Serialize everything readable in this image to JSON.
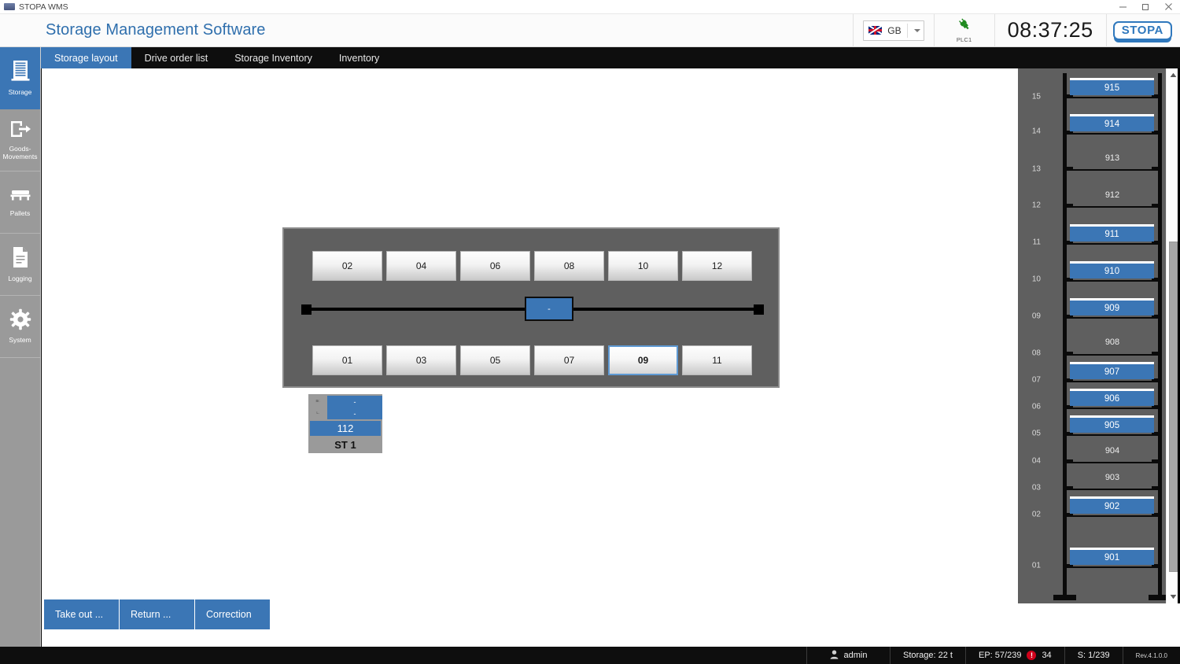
{
  "window": {
    "title": "STOPA WMS",
    "icon": "app-icon",
    "controls": [
      {
        "name": "minimize",
        "glyph": "─"
      },
      {
        "name": "restore",
        "glyph": "❐"
      },
      {
        "name": "close",
        "glyph": "✕"
      }
    ]
  },
  "header": {
    "title": "Storage Management Software",
    "language": {
      "code": "GB",
      "flag": "uk-flag-icon",
      "caret": "chevron-down-icon"
    },
    "plc": {
      "label": "PLC1",
      "icon": "plug-connected-icon",
      "status_color": "#1f8a1f"
    },
    "clock": "08:37:25",
    "logo": "STOPA"
  },
  "sidebar": {
    "items": [
      {
        "label": "Storage",
        "icon": "storage-rack-icon",
        "active": true
      },
      {
        "label": "Goods-\nMovements",
        "icon": "goods-movement-icon",
        "active": false
      },
      {
        "label": "Pallets",
        "icon": "pallet-icon",
        "active": false
      },
      {
        "label": "Logging",
        "icon": "document-log-icon",
        "active": false
      },
      {
        "label": "System",
        "icon": "gear-icon",
        "active": false
      }
    ]
  },
  "tabs": [
    {
      "label": "Storage layout",
      "active": true
    },
    {
      "label": "Drive order list",
      "active": false
    },
    {
      "label": "Storage Inventory",
      "active": false
    },
    {
      "label": "Inventory",
      "active": false
    }
  ],
  "storage_layout": {
    "top_row": [
      {
        "label": "02",
        "selected": false
      },
      {
        "label": "04",
        "selected": false
      },
      {
        "label": "06",
        "selected": false
      },
      {
        "label": "08",
        "selected": false
      },
      {
        "label": "10",
        "selected": false
      },
      {
        "label": "12",
        "selected": false
      }
    ],
    "bottom_row": [
      {
        "label": "01",
        "selected": false
      },
      {
        "label": "03",
        "selected": false
      },
      {
        "label": "05",
        "selected": false
      },
      {
        "label": "07",
        "selected": false
      },
      {
        "label": "09",
        "selected": true
      },
      {
        "label": "11",
        "selected": false
      }
    ],
    "crane": {
      "label": "-"
    },
    "station": {
      "side_labels": [
        "Br.",
        "L."
      ],
      "cells": [
        "-",
        "-"
      ],
      "bar_value": "112",
      "name": "ST 1"
    }
  },
  "rack": {
    "levels": [
      {
        "tick": "15",
        "shelf": "915",
        "occupied": true
      },
      {
        "tick": "14",
        "shelf": "914",
        "occupied": true
      },
      {
        "tick": "13",
        "shelf": "913",
        "occupied": false
      },
      {
        "tick": "12",
        "shelf": "912",
        "occupied": false
      },
      {
        "tick": "11",
        "shelf": "911",
        "occupied": true
      },
      {
        "tick": "10",
        "shelf": "910",
        "occupied": true
      },
      {
        "tick": "09",
        "shelf": "909",
        "occupied": true
      },
      {
        "tick": "08",
        "shelf": "908",
        "occupied": false
      },
      {
        "tick": "07",
        "shelf": "907",
        "occupied": true
      },
      {
        "tick": "06",
        "shelf": "906",
        "occupied": true
      },
      {
        "tick": "05",
        "shelf": "905",
        "occupied": true
      },
      {
        "tick": "04",
        "shelf": "904",
        "occupied": false
      },
      {
        "tick": "03",
        "shelf": "903",
        "occupied": false
      },
      {
        "tick": "02",
        "shelf": "902",
        "occupied": true
      },
      {
        "tick": "01",
        "shelf": "901",
        "occupied": true
      }
    ],
    "scrollbar": {
      "up": "▲",
      "down": "▼"
    }
  },
  "actions": [
    {
      "label": "Take out ..."
    },
    {
      "label": "Return ..."
    },
    {
      "label": "Correction"
    }
  ],
  "status": {
    "user": "admin",
    "user_icon": "user-icon",
    "storage": "Storage:  22  t",
    "ep": "EP: 57/239",
    "alerts": "34",
    "s": "S: 1/239",
    "revision": "Rev.4.1.0.0"
  },
  "colors": {
    "accent": "#3b76b5",
    "title": "#2f6fad",
    "panel": "#5f5f5f",
    "sidebar": "#9a9a9a",
    "alert": "#d0021b",
    "dark": "#0e0e0e"
  }
}
